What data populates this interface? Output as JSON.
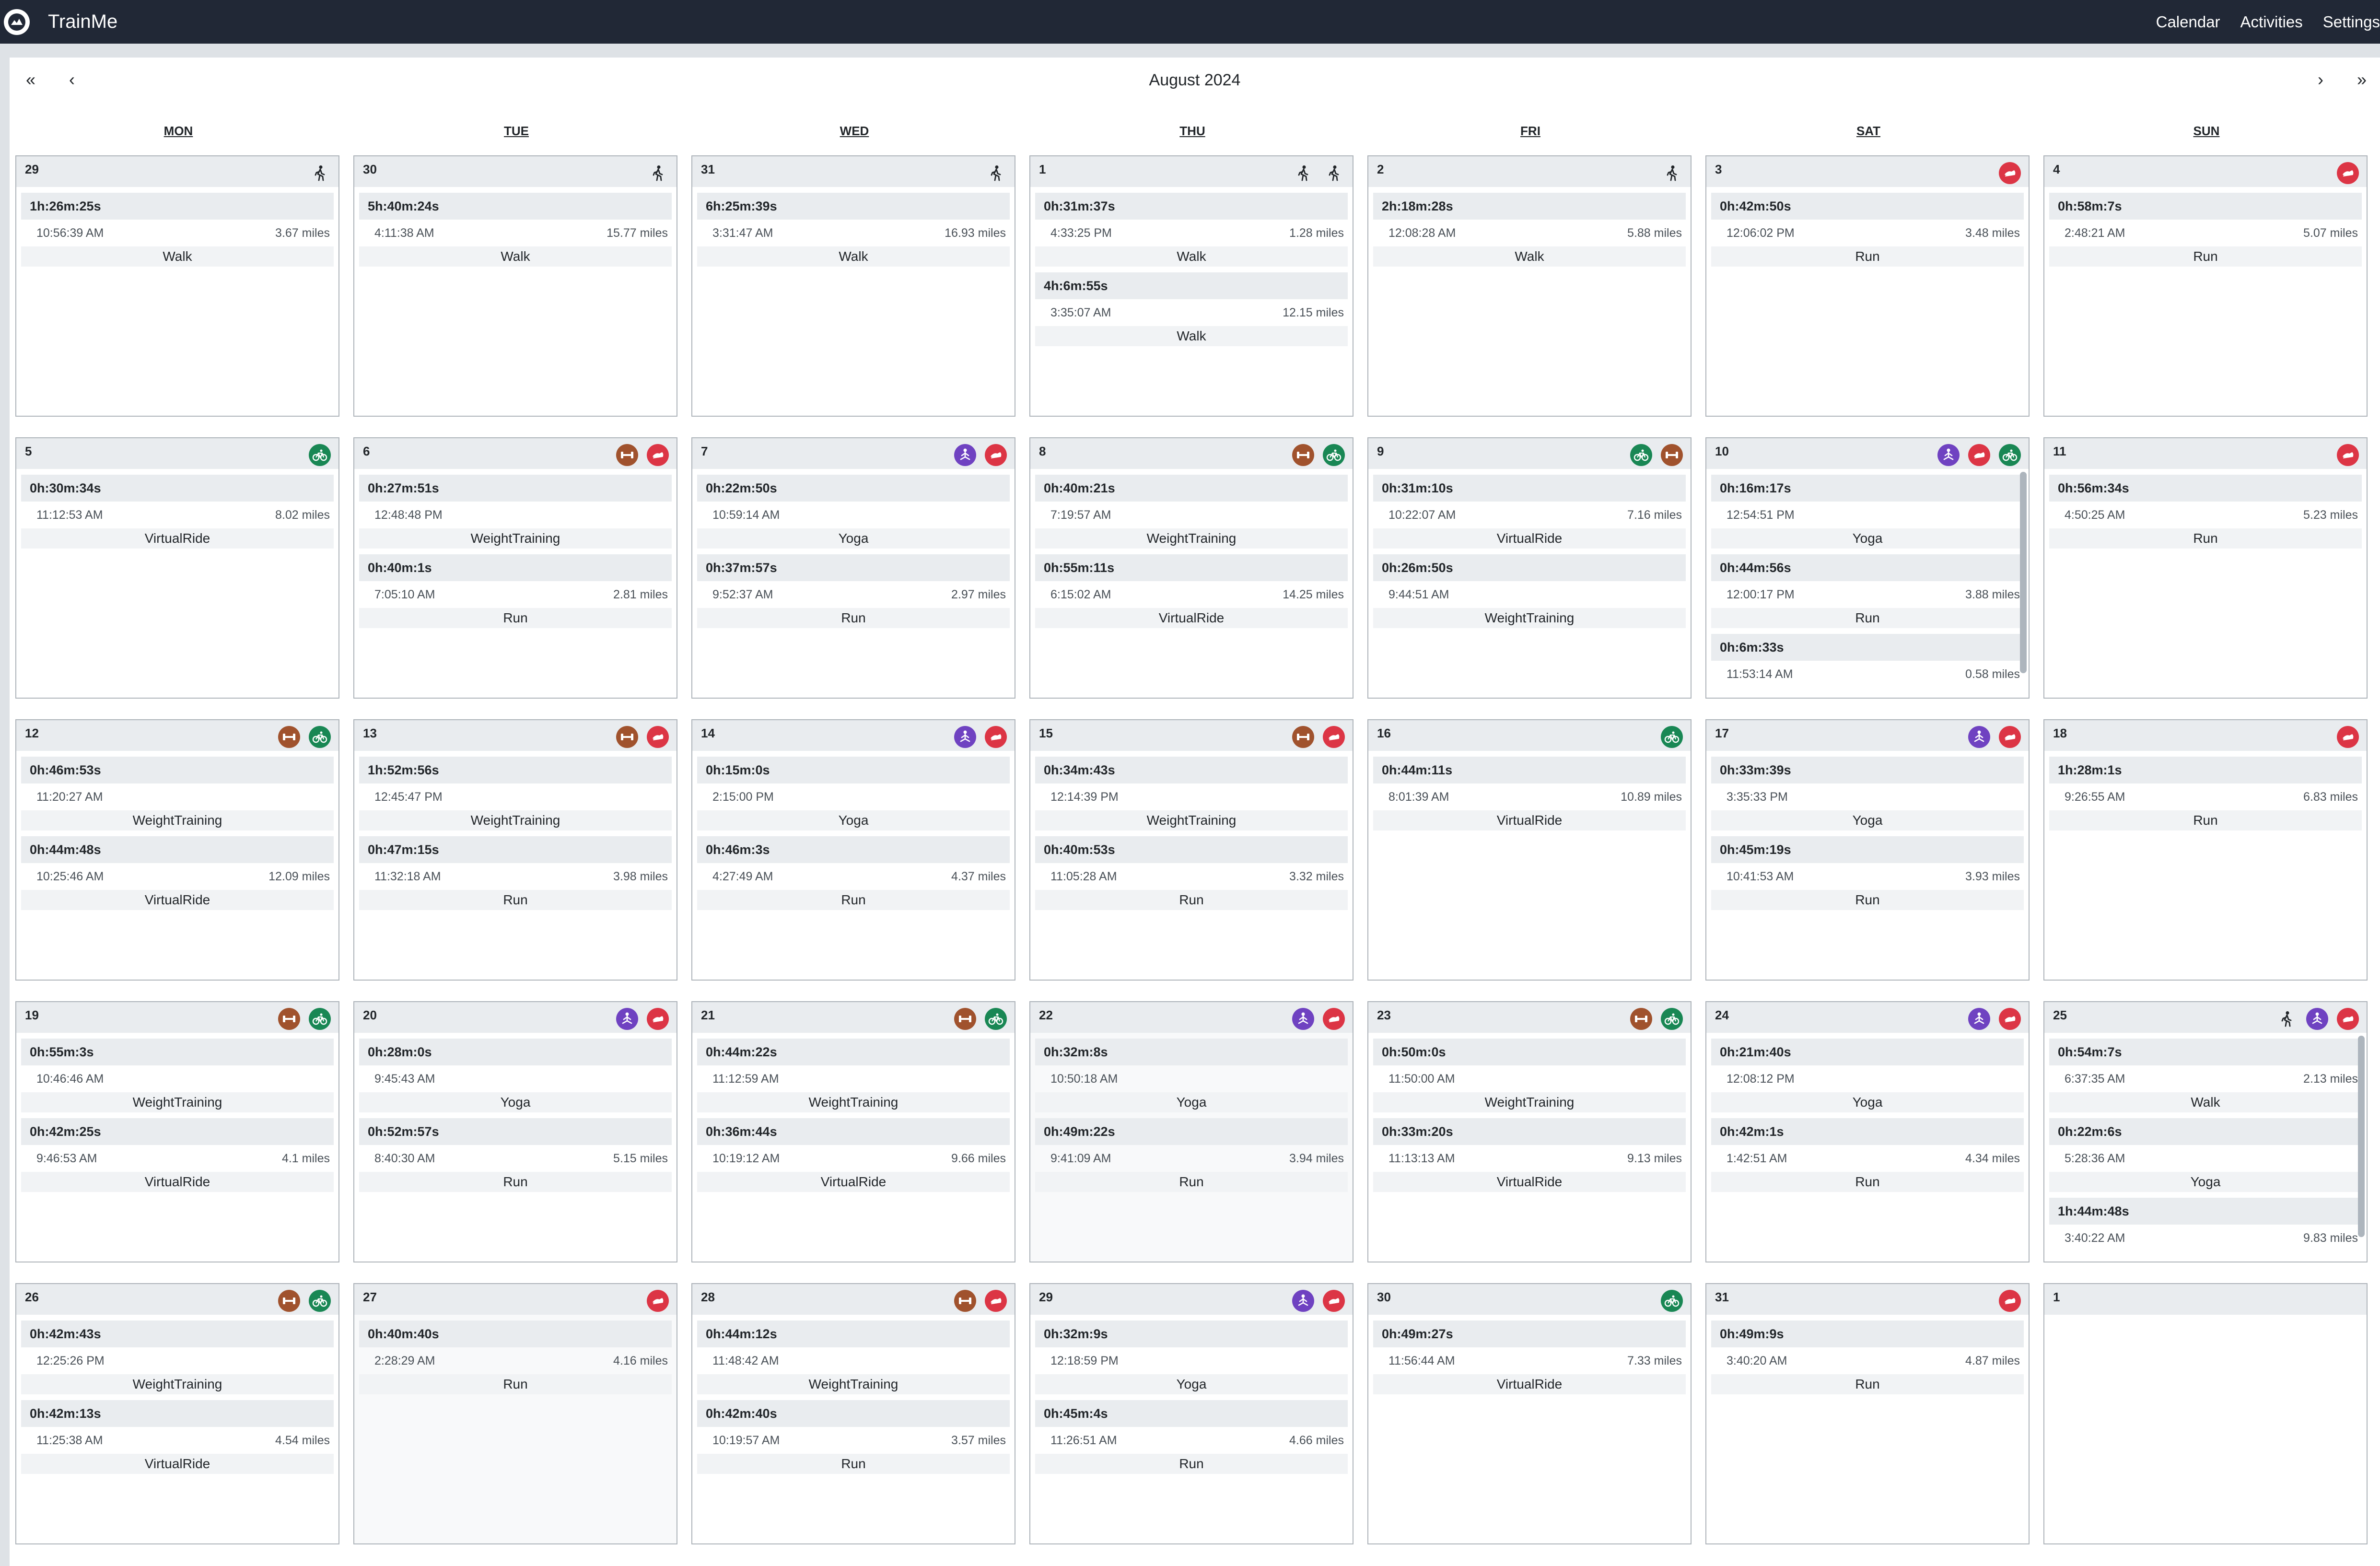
{
  "app": {
    "name": "TrainMe"
  },
  "nav": [
    "Calendar",
    "Activities",
    "Settings"
  ],
  "calendar": {
    "title": "August 2024",
    "prev_year": "«",
    "prev_month": "‹",
    "next_month": "›",
    "next_year": "»",
    "weekdays": [
      "MON",
      "TUE",
      "WED",
      "THU",
      "FRI",
      "SAT",
      "SUN"
    ],
    "days": [
      {
        "day": "29",
        "icons": [
          "walk"
        ],
        "activities": [
          {
            "duration": "1h:26m:25s",
            "time": "10:56:39 AM",
            "distance": "3.67 miles",
            "type": "Walk"
          }
        ]
      },
      {
        "day": "30",
        "icons": [
          "walk"
        ],
        "activities": [
          {
            "duration": "5h:40m:24s",
            "time": "4:11:38 AM",
            "distance": "15.77 miles",
            "type": "Walk"
          }
        ]
      },
      {
        "day": "31",
        "icons": [
          "walk"
        ],
        "activities": [
          {
            "duration": "6h:25m:39s",
            "time": "3:31:47 AM",
            "distance": "16.93 miles",
            "type": "Walk"
          }
        ]
      },
      {
        "day": "1",
        "icons": [
          "walk",
          "walk"
        ],
        "activities": [
          {
            "duration": "0h:31m:37s",
            "time": "4:33:25 PM",
            "distance": "1.28 miles",
            "type": "Walk"
          },
          {
            "duration": "4h:6m:55s",
            "time": "3:35:07 AM",
            "distance": "12.15 miles",
            "type": "Walk"
          }
        ]
      },
      {
        "day": "2",
        "icons": [
          "walk"
        ],
        "activities": [
          {
            "duration": "2h:18m:28s",
            "time": "12:08:28 AM",
            "distance": "5.88 miles",
            "type": "Walk"
          }
        ]
      },
      {
        "day": "3",
        "icons": [
          "run"
        ],
        "activities": [
          {
            "duration": "0h:42m:50s",
            "time": "12:06:02 PM",
            "distance": "3.48 miles",
            "type": "Run"
          }
        ]
      },
      {
        "day": "4",
        "icons": [
          "run"
        ],
        "activities": [
          {
            "duration": "0h:58m:7s",
            "time": "2:48:21 AM",
            "distance": "5.07 miles",
            "type": "Run"
          }
        ]
      },
      {
        "day": "5",
        "icons": [
          "ride"
        ],
        "activities": [
          {
            "duration": "0h:30m:34s",
            "time": "11:12:53 AM",
            "distance": "8.02 miles",
            "type": "VirtualRide"
          }
        ]
      },
      {
        "day": "6",
        "icons": [
          "wt",
          "run"
        ],
        "activities": [
          {
            "duration": "0h:27m:51s",
            "time": "12:48:48 PM",
            "distance": "",
            "type": "WeightTraining"
          },
          {
            "duration": "0h:40m:1s",
            "time": "7:05:10 AM",
            "distance": "2.81 miles",
            "type": "Run"
          }
        ]
      },
      {
        "day": "7",
        "icons": [
          "yoga",
          "run"
        ],
        "activities": [
          {
            "duration": "0h:22m:50s",
            "time": "10:59:14 AM",
            "distance": "",
            "type": "Yoga"
          },
          {
            "duration": "0h:37m:57s",
            "time": "9:52:37 AM",
            "distance": "2.97 miles",
            "type": "Run"
          }
        ]
      },
      {
        "day": "8",
        "icons": [
          "wt",
          "ride"
        ],
        "activities": [
          {
            "duration": "0h:40m:21s",
            "time": "7:19:57 AM",
            "distance": "",
            "type": "WeightTraining"
          },
          {
            "duration": "0h:55m:11s",
            "time": "6:15:02 AM",
            "distance": "14.25 miles",
            "type": "VirtualRide"
          }
        ]
      },
      {
        "day": "9",
        "icons": [
          "ride",
          "wt"
        ],
        "activities": [
          {
            "duration": "0h:31m:10s",
            "time": "10:22:07 AM",
            "distance": "7.16 miles",
            "type": "VirtualRide"
          },
          {
            "duration": "0h:26m:50s",
            "time": "9:44:51 AM",
            "distance": "",
            "type": "WeightTraining"
          }
        ]
      },
      {
        "day": "10",
        "icons": [
          "yoga",
          "run",
          "ride"
        ],
        "scroll": true,
        "activities": [
          {
            "duration": "0h:16m:17s",
            "time": "12:54:51 PM",
            "distance": "",
            "type": "Yoga"
          },
          {
            "duration": "0h:44m:56s",
            "time": "12:00:17 PM",
            "distance": "3.88 miles",
            "type": "Run"
          },
          {
            "duration": "0h:6m:33s",
            "time": "11:53:14 AM",
            "distance": "0.58 miles",
            "type": ""
          }
        ]
      },
      {
        "day": "11",
        "icons": [
          "run"
        ],
        "activities": [
          {
            "duration": "0h:56m:34s",
            "time": "4:50:25 AM",
            "distance": "5.23 miles",
            "type": "Run"
          }
        ]
      },
      {
        "day": "12",
        "icons": [
          "wt",
          "ride"
        ],
        "activities": [
          {
            "duration": "0h:46m:53s",
            "time": "11:20:27 AM",
            "distance": "",
            "type": "WeightTraining"
          },
          {
            "duration": "0h:44m:48s",
            "time": "10:25:46 AM",
            "distance": "12.09 miles",
            "type": "VirtualRide"
          }
        ]
      },
      {
        "day": "13",
        "icons": [
          "wt",
          "run"
        ],
        "activities": [
          {
            "duration": "1h:52m:56s",
            "time": "12:45:47 PM",
            "distance": "",
            "type": "WeightTraining"
          },
          {
            "duration": "0h:47m:15s",
            "time": "11:32:18 AM",
            "distance": "3.98 miles",
            "type": "Run"
          }
        ]
      },
      {
        "day": "14",
        "icons": [
          "yoga",
          "run"
        ],
        "activities": [
          {
            "duration": "0h:15m:0s",
            "time": "2:15:00 PM",
            "distance": "",
            "type": "Yoga"
          },
          {
            "duration": "0h:46m:3s",
            "time": "4:27:49 AM",
            "distance": "4.37 miles",
            "type": "Run"
          }
        ]
      },
      {
        "day": "15",
        "icons": [
          "wt",
          "run"
        ],
        "activities": [
          {
            "duration": "0h:34m:43s",
            "time": "12:14:39 PM",
            "distance": "",
            "type": "WeightTraining"
          },
          {
            "duration": "0h:40m:53s",
            "time": "11:05:28 AM",
            "distance": "3.32 miles",
            "type": "Run"
          }
        ]
      },
      {
        "day": "16",
        "icons": [
          "ride"
        ],
        "activities": [
          {
            "duration": "0h:44m:11s",
            "time": "8:01:39 AM",
            "distance": "10.89 miles",
            "type": "VirtualRide"
          }
        ]
      },
      {
        "day": "17",
        "icons": [
          "yoga",
          "run"
        ],
        "activities": [
          {
            "duration": "0h:33m:39s",
            "time": "3:35:33 PM",
            "distance": "",
            "type": "Yoga"
          },
          {
            "duration": "0h:45m:19s",
            "time": "10:41:53 AM",
            "distance": "3.93 miles",
            "type": "Run"
          }
        ]
      },
      {
        "day": "18",
        "icons": [
          "run"
        ],
        "activities": [
          {
            "duration": "1h:28m:1s",
            "time": "9:26:55 AM",
            "distance": "6.83 miles",
            "type": "Run"
          }
        ]
      },
      {
        "day": "19",
        "icons": [
          "wt",
          "ride"
        ],
        "activities": [
          {
            "duration": "0h:55m:3s",
            "time": "10:46:46 AM",
            "distance": "",
            "type": "WeightTraining"
          },
          {
            "duration": "0h:42m:25s",
            "time": "9:46:53 AM",
            "distance": "4.1 miles",
            "type": "VirtualRide"
          }
        ]
      },
      {
        "day": "20",
        "icons": [
          "yoga",
          "run"
        ],
        "activities": [
          {
            "duration": "0h:28m:0s",
            "time": "9:45:43 AM",
            "distance": "",
            "type": "Yoga"
          },
          {
            "duration": "0h:52m:57s",
            "time": "8:40:30 AM",
            "distance": "5.15 miles",
            "type": "Run"
          }
        ]
      },
      {
        "day": "21",
        "icons": [
          "wt",
          "ride"
        ],
        "activities": [
          {
            "duration": "0h:44m:22s",
            "time": "11:12:59 AM",
            "distance": "",
            "type": "WeightTraining"
          },
          {
            "duration": "0h:36m:44s",
            "time": "10:19:12 AM",
            "distance": "9.66 miles",
            "type": "VirtualRide"
          }
        ]
      },
      {
        "day": "22",
        "icons": [
          "yoga",
          "run"
        ],
        "shaded": true,
        "activities": [
          {
            "duration": "0h:32m:8s",
            "time": "10:50:18 AM",
            "distance": "",
            "type": "Yoga"
          },
          {
            "duration": "0h:49m:22s",
            "time": "9:41:09 AM",
            "distance": "3.94 miles",
            "type": "Run"
          }
        ]
      },
      {
        "day": "23",
        "icons": [
          "wt",
          "ride"
        ],
        "activities": [
          {
            "duration": "0h:50m:0s",
            "time": "11:50:00 AM",
            "distance": "",
            "type": "WeightTraining"
          },
          {
            "duration": "0h:33m:20s",
            "time": "11:13:13 AM",
            "distance": "9.13 miles",
            "type": "VirtualRide"
          }
        ]
      },
      {
        "day": "24",
        "icons": [
          "yoga",
          "run"
        ],
        "activities": [
          {
            "duration": "0h:21m:40s",
            "time": "12:08:12 PM",
            "distance": "",
            "type": "Yoga"
          },
          {
            "duration": "0h:42m:1s",
            "time": "1:42:51 AM",
            "distance": "4.34 miles",
            "type": "Run"
          }
        ]
      },
      {
        "day": "25",
        "icons": [
          "walk",
          "yoga",
          "run"
        ],
        "scroll": true,
        "activities": [
          {
            "duration": "0h:54m:7s",
            "time": "6:37:35 AM",
            "distance": "2.13 miles",
            "type": "Walk"
          },
          {
            "duration": "0h:22m:6s",
            "time": "5:28:36 AM",
            "distance": "",
            "type": "Yoga"
          },
          {
            "duration": "1h:44m:48s",
            "time": "3:40:22 AM",
            "distance": "9.83 miles",
            "type": ""
          }
        ]
      },
      {
        "day": "26",
        "icons": [
          "wt",
          "ride"
        ],
        "activities": [
          {
            "duration": "0h:42m:43s",
            "time": "12:25:26 PM",
            "distance": "",
            "type": "WeightTraining"
          },
          {
            "duration": "0h:42m:13s",
            "time": "11:25:38 AM",
            "distance": "4.54 miles",
            "type": "VirtualRide"
          }
        ]
      },
      {
        "day": "27",
        "icons": [
          "run"
        ],
        "shaded": true,
        "activities": [
          {
            "duration": "0h:40m:40s",
            "time": "2:28:29 AM",
            "distance": "4.16 miles",
            "type": "Run"
          }
        ]
      },
      {
        "day": "28",
        "icons": [
          "wt",
          "run"
        ],
        "activities": [
          {
            "duration": "0h:44m:12s",
            "time": "11:48:42 AM",
            "distance": "",
            "type": "WeightTraining"
          },
          {
            "duration": "0h:42m:40s",
            "time": "10:19:57 AM",
            "distance": "3.57 miles",
            "type": "Run"
          }
        ]
      },
      {
        "day": "29",
        "icons": [
          "yoga",
          "run"
        ],
        "activities": [
          {
            "duration": "0h:32m:9s",
            "time": "12:18:59 PM",
            "distance": "",
            "type": "Yoga"
          },
          {
            "duration": "0h:45m:4s",
            "time": "11:26:51 AM",
            "distance": "4.66 miles",
            "type": "Run"
          }
        ]
      },
      {
        "day": "30",
        "icons": [
          "ride"
        ],
        "activities": [
          {
            "duration": "0h:49m:27s",
            "time": "11:56:44 AM",
            "distance": "7.33 miles",
            "type": "VirtualRide"
          }
        ]
      },
      {
        "day": "31",
        "icons": [
          "run"
        ],
        "activities": [
          {
            "duration": "0h:49m:9s",
            "time": "3:40:20 AM",
            "distance": "4.87 miles",
            "type": "Run"
          }
        ]
      },
      {
        "day": "1",
        "icons": [],
        "activities": []
      }
    ]
  },
  "colors": {
    "navbar": "#212836",
    "run": "#dc3545",
    "ride": "#198754",
    "yoga": "#6f42c1",
    "weight_training": "#a0522d"
  }
}
